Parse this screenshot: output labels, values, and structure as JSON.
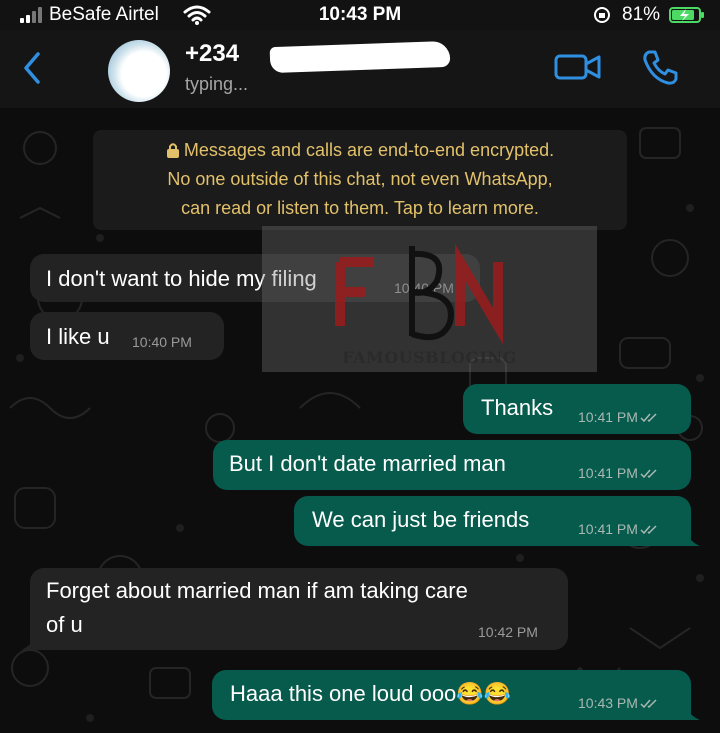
{
  "status_bar": {
    "carrier": "BeSafe Airtel",
    "time": "10:43 PM",
    "battery": "81%"
  },
  "header": {
    "contact_number": "+234",
    "status": "typing..."
  },
  "encryption_notice": {
    "line1": "Messages and calls are end-to-end encrypted.",
    "line2": "No one outside of this chat, not even WhatsApp,",
    "line3": "can read or listen to them. Tap to learn more."
  },
  "watermark": {
    "text": "FAMOUSBLOGING"
  },
  "messages": [
    {
      "direction": "incoming",
      "text": "I don't want to hide my filing",
      "time": "10:40 PM"
    },
    {
      "direction": "incoming",
      "text": "I like u",
      "time": "10:40 PM"
    },
    {
      "direction": "outgoing",
      "text": "Thanks",
      "time": "10:41 PM"
    },
    {
      "direction": "outgoing",
      "text": "But I don't date married man",
      "time": "10:41 PM"
    },
    {
      "direction": "outgoing",
      "text": "We can just be friends",
      "time": "10:41 PM"
    },
    {
      "direction": "incoming",
      "text_line1": "Forget about married man if am taking care",
      "text_line2": "of u",
      "time": "10:42 PM"
    },
    {
      "direction": "outgoing",
      "text": "Haaa this one loud ooo😂😂",
      "time": "10:43 PM"
    }
  ],
  "colors": {
    "incoming_bubble": "#232323",
    "outgoing_bubble": "#075b4c",
    "accent_blue": "#2f8fe0",
    "encryption_text": "#e2c16a"
  }
}
